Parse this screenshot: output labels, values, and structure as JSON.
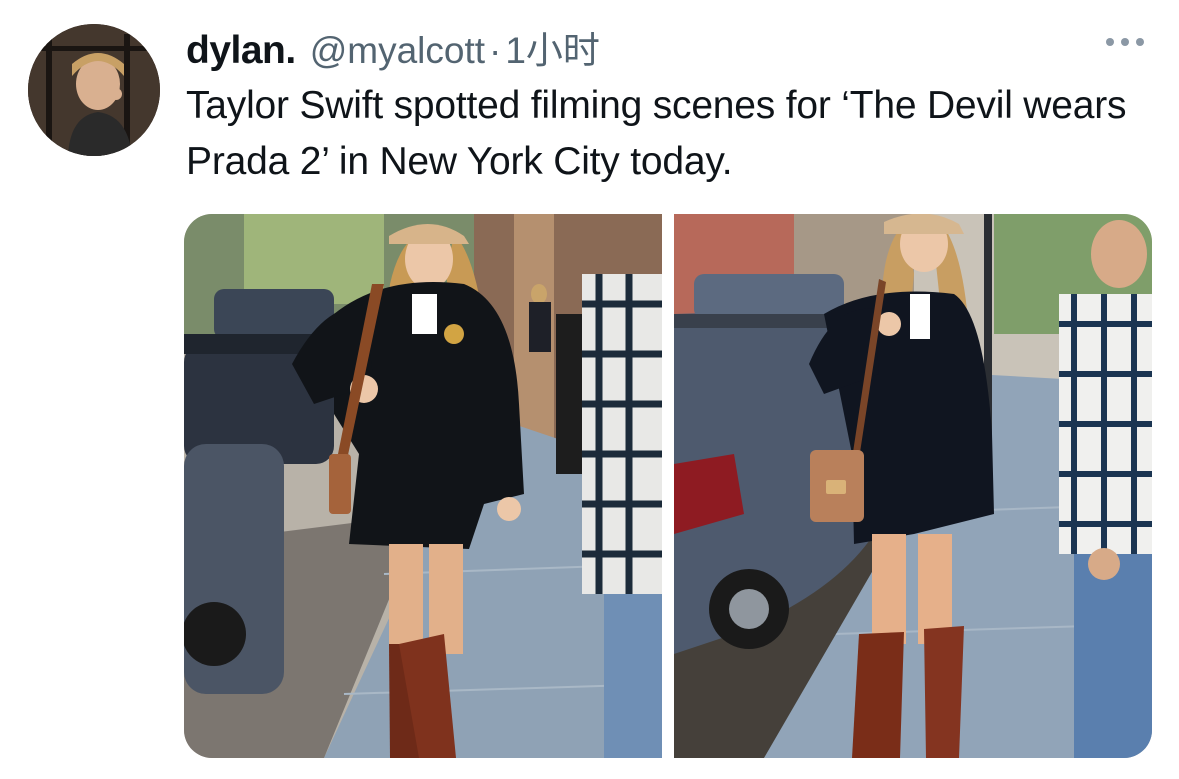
{
  "tweet": {
    "display_name": "dylan.",
    "handle": "@myalcott",
    "separator": "·",
    "time": "1小时",
    "text": "Taylor Swift spotted filming scenes for ‘The Devil wears Prada 2’ in New York City today.",
    "more_icon": "more-horizontal-icon"
  },
  "media": {
    "photos": [
      {
        "icon": "photo-1"
      },
      {
        "icon": "photo-2"
      }
    ]
  }
}
